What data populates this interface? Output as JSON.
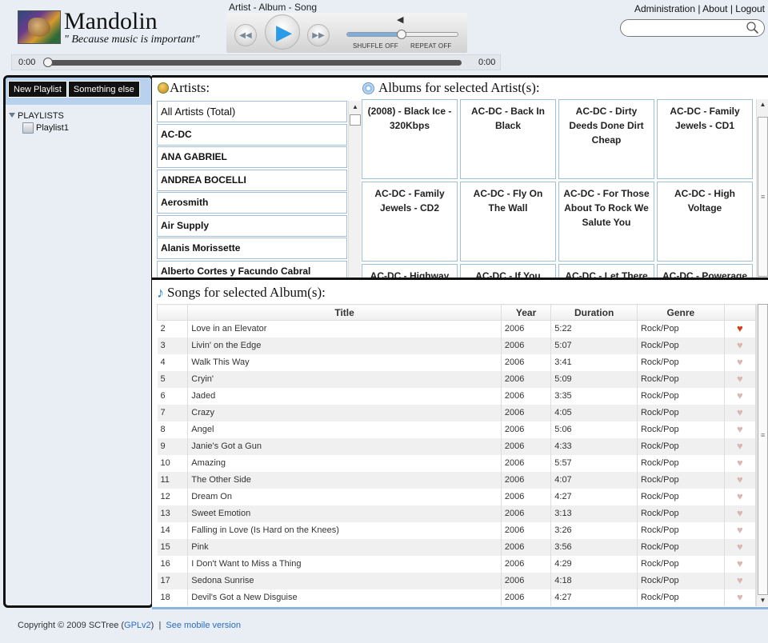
{
  "header": {
    "app_title": "Mandolin",
    "tagline": "\" Because music is important\"",
    "now_playing": "Artist - Album - Song",
    "links": [
      "Administration",
      "About",
      "Logout"
    ],
    "search": {
      "value": "",
      "placeholder": ""
    }
  },
  "player": {
    "shuffle_label": "SHUFFLE OFF",
    "repeat_label": "REPEAT OFF",
    "volume_level": 0.5,
    "time_elapsed": "0:00",
    "time_total": "0:00",
    "seek_position": 0
  },
  "sidebar": {
    "buttons": [
      "New Playlist",
      "Something else"
    ],
    "tree_root": "PLAYLISTS",
    "playlists": [
      "Playlist1"
    ]
  },
  "artists": {
    "title": "Artists:",
    "items": [
      "All Artists (Total)",
      "AC-DC",
      "ANA GABRIEL",
      "ANDREA BOCELLI",
      "Aerosmith",
      "Air Supply",
      "Alanis Morissette",
      "Alberto Cortes y Facundo Cabral"
    ]
  },
  "albums": {
    "title": "Albums for selected Artist(s):",
    "items": [
      "(2008) - Black Ice - 320Kbps",
      "AC-DC - Back In Black",
      "AC-DC - Dirty Deeds Done Dirt Cheap",
      "AC-DC - Family Jewels - CD1",
      "AC-DC - Family Jewels - CD2",
      "AC-DC - Fly On The Wall",
      "AC-DC - For Those About To Rock We Salute You",
      "AC-DC - High Voltage",
      "AC-DC - Highway",
      "AC-DC - If You Want",
      "AC-DC - Let There",
      "AC-DC - Powerage"
    ]
  },
  "songs": {
    "title": "Songs for selected Album(s):",
    "columns": [
      "",
      "Title",
      "Year",
      "Duration",
      "Genre",
      ""
    ],
    "rows": [
      {
        "track": "2",
        "title": "Love in an Elevator",
        "year": "2006",
        "duration": "5:22",
        "genre": "Rock/Pop",
        "loved": true
      },
      {
        "track": "3",
        "title": "Livin' on the Edge",
        "year": "2006",
        "duration": "5:07",
        "genre": "Rock/Pop",
        "loved": false
      },
      {
        "track": "4",
        "title": "Walk This Way",
        "year": "2006",
        "duration": "3:41",
        "genre": "Rock/Pop",
        "loved": false
      },
      {
        "track": "5",
        "title": "Cryin'",
        "year": "2006",
        "duration": "5:09",
        "genre": "Rock/Pop",
        "loved": false
      },
      {
        "track": "6",
        "title": "Jaded",
        "year": "2006",
        "duration": "3:35",
        "genre": "Rock/Pop",
        "loved": false
      },
      {
        "track": "7",
        "title": "Crazy",
        "year": "2006",
        "duration": "4:05",
        "genre": "Rock/Pop",
        "loved": false
      },
      {
        "track": "8",
        "title": "Angel",
        "year": "2006",
        "duration": "5:06",
        "genre": "Rock/Pop",
        "loved": false
      },
      {
        "track": "9",
        "title": "Janie's Got a Gun",
        "year": "2006",
        "duration": "4:33",
        "genre": "Rock/Pop",
        "loved": false
      },
      {
        "track": "10",
        "title": "Amazing",
        "year": "2006",
        "duration": "5:57",
        "genre": "Rock/Pop",
        "loved": false
      },
      {
        "track": "11",
        "title": "The Other Side",
        "year": "2006",
        "duration": "4:07",
        "genre": "Rock/Pop",
        "loved": false
      },
      {
        "track": "12",
        "title": "Dream On",
        "year": "2006",
        "duration": "4:27",
        "genre": "Rock/Pop",
        "loved": false
      },
      {
        "track": "13",
        "title": "Sweet Emotion",
        "year": "2006",
        "duration": "3:13",
        "genre": "Rock/Pop",
        "loved": false
      },
      {
        "track": "14",
        "title": "Falling in Love (Is Hard on the Knees)",
        "year": "2006",
        "duration": "3:26",
        "genre": "Rock/Pop",
        "loved": false
      },
      {
        "track": "15",
        "title": "Pink",
        "year": "2006",
        "duration": "3:56",
        "genre": "Rock/Pop",
        "loved": false
      },
      {
        "track": "16",
        "title": "I Don't Want to Miss a Thing",
        "year": "2006",
        "duration": "4:29",
        "genre": "Rock/Pop",
        "loved": false
      },
      {
        "track": "17",
        "title": "Sedona Sunrise",
        "year": "2006",
        "duration": "4:18",
        "genre": "Rock/Pop",
        "loved": false
      },
      {
        "track": "18",
        "title": "Devil's Got a New Disguise",
        "year": "2006",
        "duration": "4:27",
        "genre": "Rock/Pop",
        "loved": false
      }
    ]
  },
  "footer": {
    "copyright": "Copyright © 2009 SCTree (",
    "license_link": "GPLv2",
    "separator": ")  |  ",
    "mobile_link": "See mobile version"
  },
  "icons": {
    "heart_loved_color": "#c9431c",
    "heart_unloved_color": "#d9b8b0",
    "play_color": "#2a9be8",
    "panel_accent": "#b8d2ee"
  }
}
